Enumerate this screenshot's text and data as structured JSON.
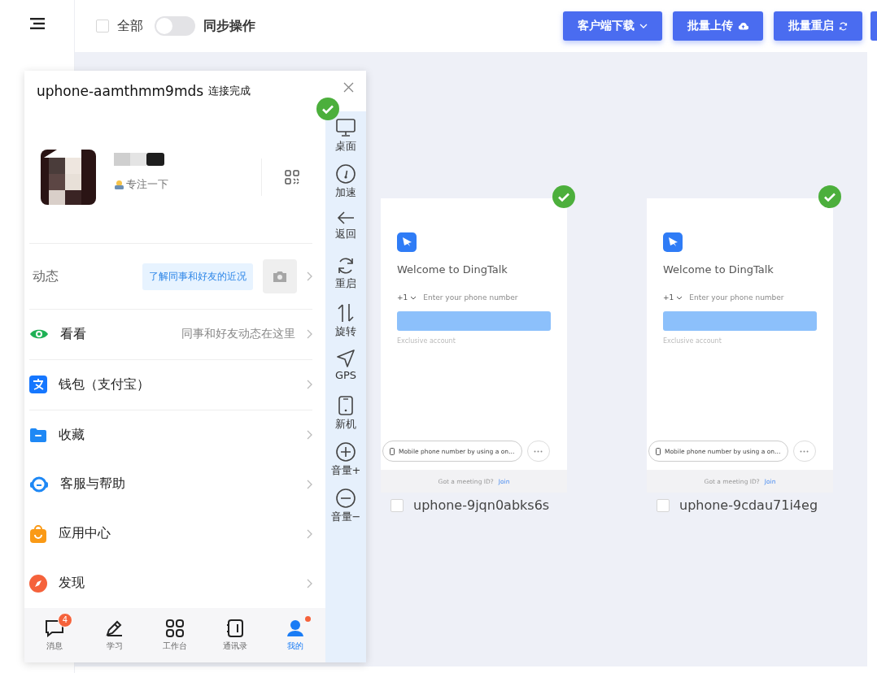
{
  "toolbar": {
    "select_all": {
      "label": "全部",
      "checked": false
    },
    "sync": {
      "label": "同步操作",
      "on": false
    },
    "buttons": [
      {
        "label": "客户端下载",
        "kind": "dropdown"
      },
      {
        "label": "批量上传",
        "kind": "upload"
      },
      {
        "label": "批量重启",
        "kind": "restart"
      }
    ]
  },
  "devices": [
    {
      "name": "uphone-9jqn0abks6s",
      "checked": false,
      "connected": true,
      "screen": {
        "title": "Welcome to DingTalk",
        "country_code": "+1",
        "phone_placeholder": "Enter your phone number",
        "link": "Exclusive account",
        "alt_login": "Mobile phone number by using a on…",
        "meeting_prompt": "Got a meeting ID?",
        "meeting_link": "Join"
      }
    },
    {
      "name": "uphone-9cdau71i4eg",
      "checked": false,
      "connected": true,
      "screen": {
        "title": "Welcome to DingTalk",
        "country_code": "+1",
        "phone_placeholder": "Enter your phone number",
        "link": "Exclusive account",
        "alt_login": "Mobile phone number by using a on…",
        "meeting_prompt": "Got a meeting ID?",
        "meeting_link": "Join"
      }
    }
  ],
  "popup": {
    "device": "uphone-aamthmm9mds",
    "status": "连接完成",
    "connected": true,
    "profile": {
      "status": "专注一下"
    },
    "moments": {
      "label": "动态",
      "hint": "了解同事和好友的近况"
    },
    "menu": [
      {
        "label": "看看",
        "detail": "同事和好友动态在这里",
        "kind": "eye"
      },
      {
        "label": "钱包（支付宝）",
        "kind": "wallet"
      },
      {
        "label": "收藏",
        "kind": "folder"
      },
      {
        "label": "客服与帮助",
        "kind": "support"
      },
      {
        "label": "应用中心",
        "kind": "bag"
      },
      {
        "label": "发现",
        "kind": "discover"
      }
    ],
    "tabs": [
      {
        "label": "消息",
        "kind": "chat",
        "badge": "4",
        "dot": false,
        "selected": false
      },
      {
        "label": "学习",
        "kind": "pen",
        "dot": false,
        "selected": false
      },
      {
        "label": "工作台",
        "kind": "grid",
        "dot": false,
        "selected": false
      },
      {
        "label": "通讯录",
        "kind": "book",
        "dot": false,
        "selected": false
      },
      {
        "label": "我的",
        "kind": "person",
        "dot": true,
        "selected": true
      }
    ],
    "tools": [
      {
        "label": "桌面",
        "kind": "desktop"
      },
      {
        "label": "加速",
        "kind": "gauge"
      },
      {
        "label": "返回",
        "kind": "back"
      },
      {
        "label": "重启",
        "kind": "restart"
      },
      {
        "label": "旋转",
        "kind": "rotate"
      },
      {
        "label": "GPS",
        "kind": "gps"
      },
      {
        "label": "新机",
        "kind": "phone"
      },
      {
        "label": "音量+",
        "kind": "plus"
      },
      {
        "label": "音量−",
        "kind": "minus"
      }
    ]
  }
}
